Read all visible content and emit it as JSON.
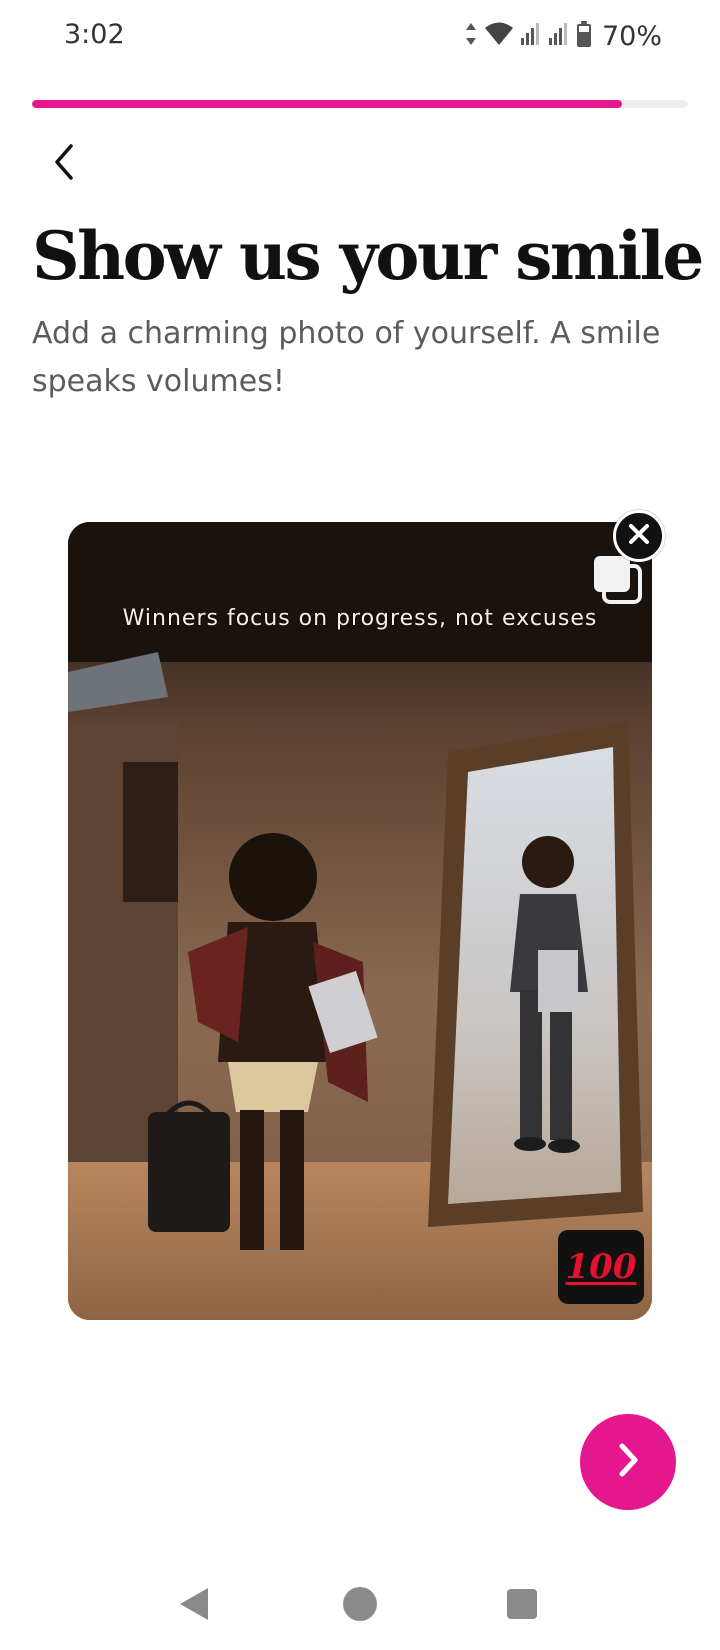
{
  "status_bar": {
    "time": "3:02",
    "battery_text": "70%",
    "icons": [
      "data-arrows-icon",
      "wifi-icon",
      "signal-icon",
      "signal-icon",
      "battery-icon"
    ]
  },
  "progress": {
    "fraction": 0.9
  },
  "header": {
    "back_icon": "chevron-left-icon"
  },
  "main": {
    "title": "Show us your smile",
    "subtitle": "Add a charming photo of yourself. A smile speaks volumes!",
    "photo": {
      "caption": "Winners focus on progress, not excuses",
      "badge_text": "100",
      "remove_icon": "close-icon",
      "multi_icon": "multiple-photos-icon"
    }
  },
  "actions": {
    "next_icon": "chevron-right-icon"
  },
  "nav": {
    "items": [
      "back-triangle-icon",
      "home-circle-icon",
      "recents-square-icon"
    ]
  },
  "colors": {
    "accent": "#e5178f",
    "title": "#111111",
    "subtitle": "#5c5c5c",
    "progress_track": "#ededed"
  }
}
